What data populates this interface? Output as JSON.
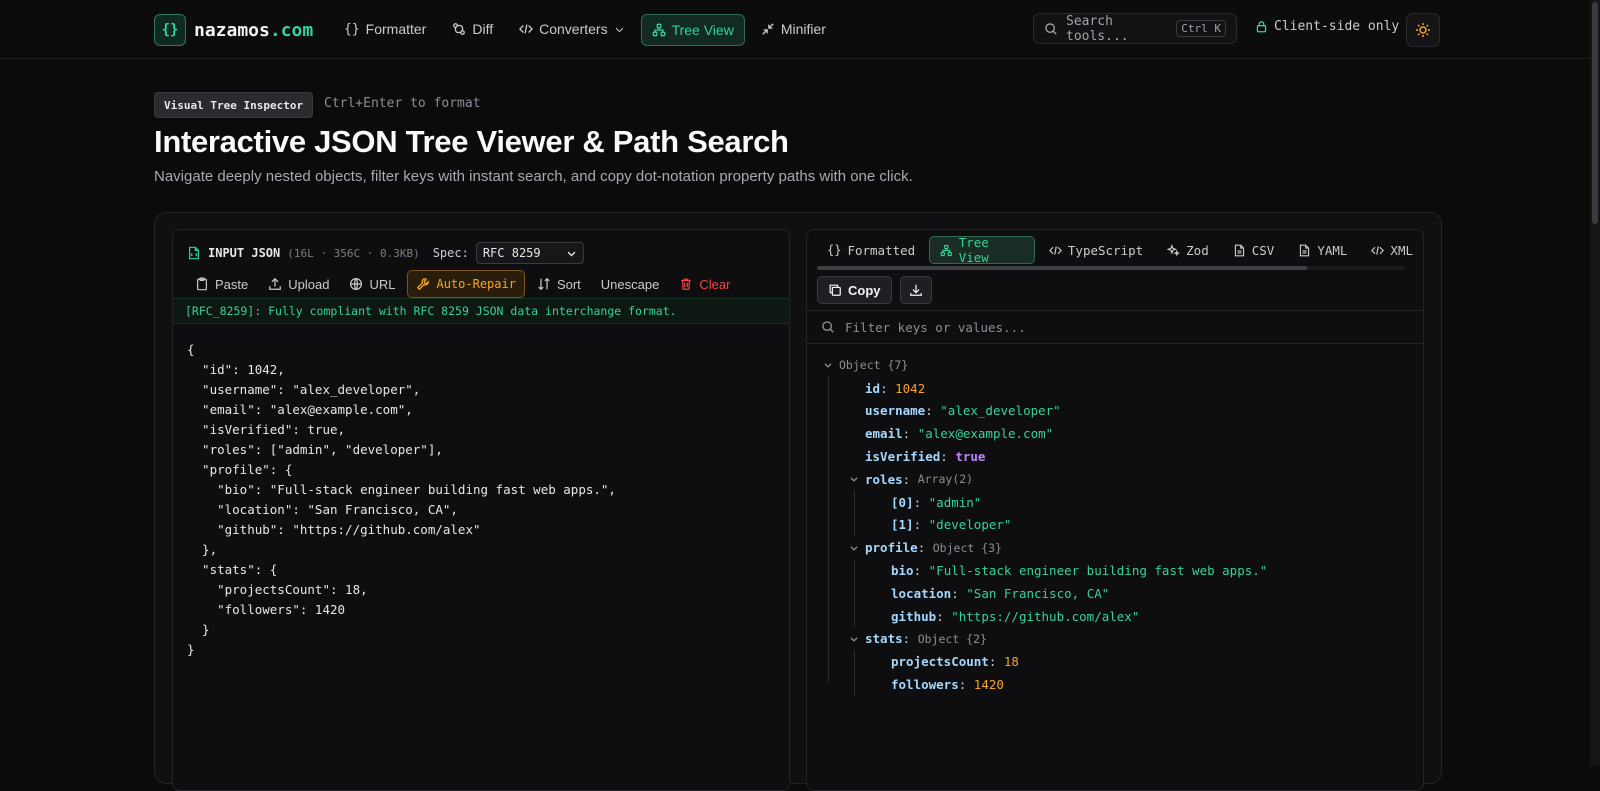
{
  "nav": {
    "logo_glyph": "{}",
    "logo_name": "nazamos",
    "logo_tld": ".com",
    "items": [
      {
        "label": "Formatter",
        "icon": "braces-icon",
        "active": false
      },
      {
        "label": "Diff",
        "icon": "git-diff-icon",
        "active": false
      },
      {
        "label": "Converters",
        "icon": "code-icon",
        "active": false,
        "dropdown": true
      },
      {
        "label": "Tree View",
        "icon": "tree-icon",
        "active": true
      },
      {
        "label": "Minifier",
        "icon": "minimize-icon",
        "active": false
      }
    ],
    "search_placeholder": "Search tools...",
    "search_kbd": "Ctrl K",
    "client_label": "Client-side only",
    "accent": "#34d399"
  },
  "hero": {
    "badge": "Visual Tree Inspector",
    "hint": "Ctrl+Enter to format",
    "title": "Interactive JSON Tree Viewer & Path Search",
    "subtitle": "Navigate deeply nested objects, filter keys with instant search, and copy dot-notation property paths with one click."
  },
  "input_panel": {
    "title": "INPUT JSON",
    "meta": "(16L · 356C · 0.3KB)",
    "spec_label": "Spec:",
    "spec_value": "RFC 8259",
    "toolbar": {
      "paste": "Paste",
      "upload": "Upload",
      "url": "URL",
      "auto_repair": "Auto-Repair",
      "sort": "Sort",
      "unescape": "Unescape",
      "clear": "Clear"
    },
    "status": "[RFC_8259]: Fully compliant with RFC 8259 JSON data interchange format.",
    "code": "{\n  \"id\": 1042,\n  \"username\": \"alex_developer\",\n  \"email\": \"alex@example.com\",\n  \"isVerified\": true,\n  \"roles\": [\"admin\", \"developer\"],\n  \"profile\": {\n    \"bio\": \"Full-stack engineer building fast web apps.\",\n    \"location\": \"San Francisco, CA\",\n    \"github\": \"https://github.com/alex\"\n  },\n  \"stats\": {\n    \"projectsCount\": 18,\n    \"followers\": 1420\n  }\n}"
  },
  "output_panel": {
    "tabs": [
      "Formatted",
      "Tree View",
      "TypeScript",
      "Zod",
      "CSV",
      "YAML",
      "XML"
    ],
    "active_tab": "Tree View",
    "copy_label": "Copy",
    "filter_placeholder": "Filter keys or values...",
    "tree": {
      "root_label": "Object {7}",
      "id_key": "id",
      "id_val": "1042",
      "username_key": "username",
      "username_val": "\"alex_developer\"",
      "email_key": "email",
      "email_val": "\"alex@example.com\"",
      "isVerified_key": "isVerified",
      "isVerified_val": "true",
      "roles_key": "roles",
      "roles_type": "Array(2)",
      "roles_0_key": "[0]",
      "roles_0_val": "\"admin\"",
      "roles_1_key": "[1]",
      "roles_1_val": "\"developer\"",
      "profile_key": "profile",
      "profile_type": "Object {3}",
      "bio_key": "bio",
      "bio_val": "\"Full-stack engineer building fast web apps.\"",
      "location_key": "location",
      "location_val": "\"San Francisco, CA\"",
      "github_key": "github",
      "github_val": "\"https://github.com/alex\"",
      "stats_key": "stats",
      "stats_type": "Object {2}",
      "projects_key": "projectsCount",
      "projects_val": "18",
      "followers_key": "followers",
      "followers_val": "1420"
    }
  }
}
